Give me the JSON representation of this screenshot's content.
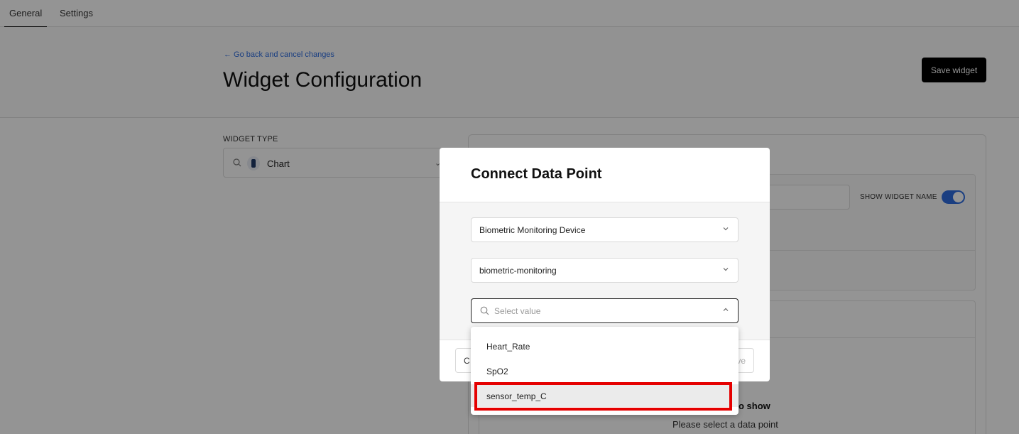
{
  "tabs": [
    {
      "label": "General",
      "active": true
    },
    {
      "label": "Settings",
      "active": false
    }
  ],
  "header": {
    "back_link": "← Go back and cancel changes",
    "title": "Widget Configuration",
    "save_label": "Save widget"
  },
  "widget_type": {
    "label": "WIDGET TYPE",
    "value": "Chart",
    "icon": "search-icon"
  },
  "panel": {
    "show_widget_name_label": "SHOW WIDGET NAME",
    "show_widget_name": true,
    "empty_title_fragment": "o show",
    "empty_subtitle": "Please select a data point"
  },
  "modal": {
    "title": "Connect Data Point",
    "device_value": "Biometric Monitoring Device",
    "source_value": "biometric-monitoring",
    "datapoint_placeholder": "Select value",
    "cancel_fragment": "C",
    "save_fragment": "ve"
  },
  "dropdown": {
    "options": [
      "Heart_Rate",
      "SpO2",
      "sensor_temp_C"
    ],
    "hovered_index": 2
  },
  "colors": {
    "accent": "#2d6cdf",
    "primary_button": "#000000",
    "highlight": "#e50000",
    "overlay": "rgba(0,0,0,0.42)"
  }
}
